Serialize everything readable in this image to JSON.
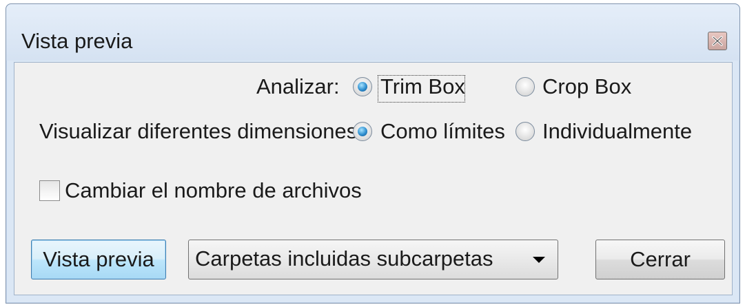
{
  "window": {
    "title": "Vista previa",
    "close_icon": "close-icon"
  },
  "analyze": {
    "label": "Analizar:",
    "options": [
      {
        "label": "Trim Box",
        "checked": true
      },
      {
        "label": "Crop Box",
        "checked": false
      }
    ]
  },
  "dimensions": {
    "label": "Visualizar diferentes dimensiones:",
    "options": [
      {
        "label": "Como límites",
        "checked": true
      },
      {
        "label": "Individualmente",
        "checked": false
      }
    ]
  },
  "rename": {
    "label": "Cambiar el nombre de archivos",
    "checked": false
  },
  "buttons": {
    "preview": "Vista previa",
    "close": "Cerrar"
  },
  "folder_select": {
    "selected": "Carpetas incluidas subcarpetas"
  }
}
